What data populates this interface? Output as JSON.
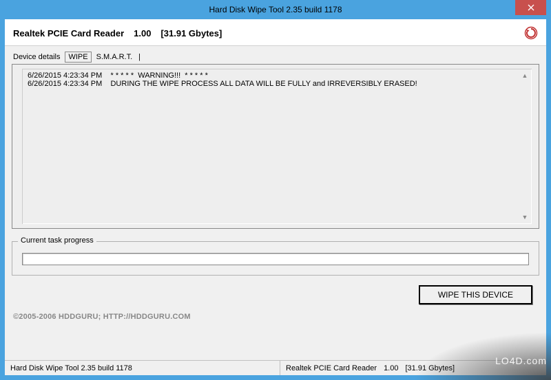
{
  "titlebar": {
    "title": "Hard Disk Wipe Tool 2.35 build 1178"
  },
  "header": {
    "device_name": "Realtek PCIE Card Reader",
    "device_version": "1.00",
    "device_size": "[31.91 Gbytes]"
  },
  "tabs": {
    "items": [
      {
        "label": "Device details",
        "active": false
      },
      {
        "label": "WIPE",
        "active": true
      },
      {
        "label": "S.M.A.R.T.",
        "active": false
      }
    ]
  },
  "log": {
    "lines": [
      {
        "time": "6/26/2015 4:23:34 PM",
        "msg": "* * * * *  WARNING!!!  * * * * *"
      },
      {
        "time": "6/26/2015 4:23:34 PM",
        "msg": "DURING THE WIPE PROCESS ALL DATA WILL BE FULLY and IRREVERSIBLY ERASED!"
      }
    ]
  },
  "progress": {
    "legend": "Current task progress",
    "percent": 0
  },
  "actions": {
    "wipe_label": "WIPE THIS DEVICE"
  },
  "footer": {
    "copyright": "©2005-2006 HDDGURU;  HTTP://HDDGURU.COM"
  },
  "statusbar": {
    "left": "Hard Disk Wipe Tool 2.35 build 1178",
    "right_device": "Realtek PCIE Card Reader",
    "right_version": "1.00",
    "right_size": "[31.91 Gbytes]"
  },
  "watermark": "LO4D.com"
}
